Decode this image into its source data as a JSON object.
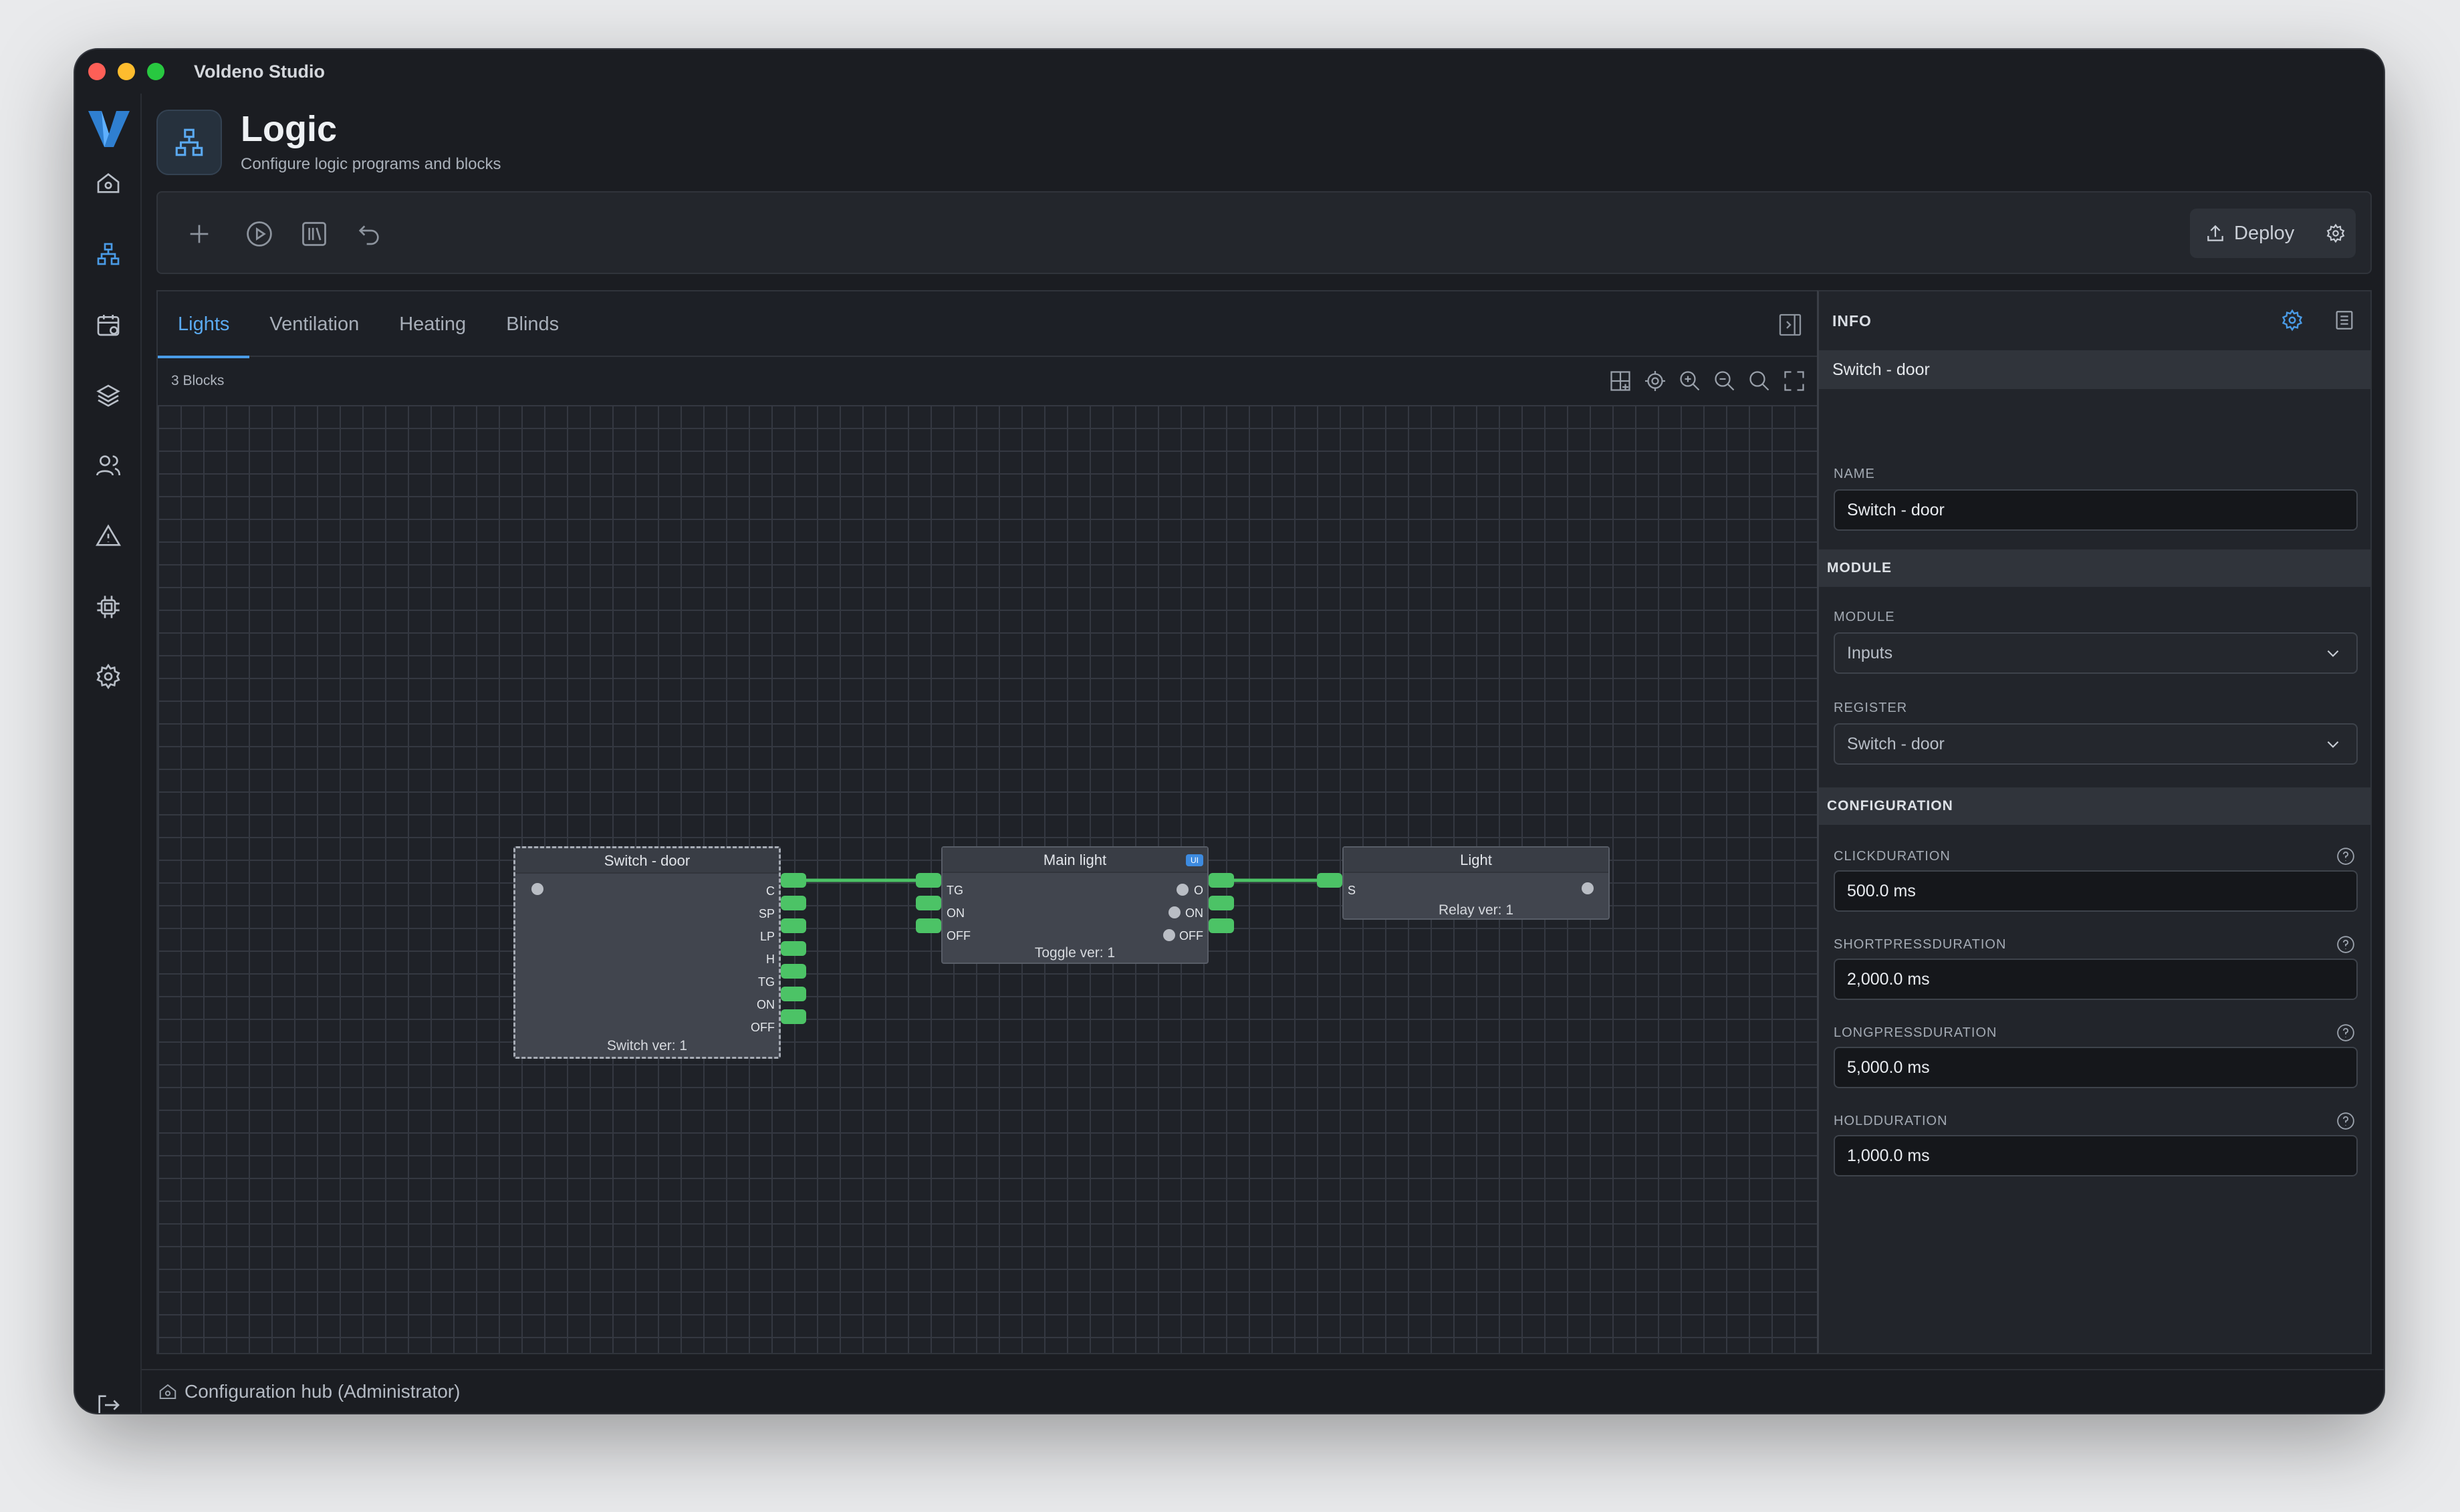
{
  "window": {
    "title": "Voldeno Studio"
  },
  "header": {
    "title": "Logic",
    "subtitle": "Configure logic programs and blocks"
  },
  "toolbar": {
    "deploy_label": "Deploy"
  },
  "tabs": [
    {
      "label": "Lights",
      "active": true
    },
    {
      "label": "Ventilation",
      "active": false
    },
    {
      "label": "Heating",
      "active": false
    },
    {
      "label": "Blinds",
      "active": false
    }
  ],
  "canvas": {
    "block_count": "3 Blocks",
    "nodes": {
      "switch": {
        "title": "Switch - door",
        "footer": "Switch ver: 1",
        "outputs": [
          "C",
          "SP",
          "LP",
          "H",
          "TG",
          "ON",
          "OFF"
        ]
      },
      "toggle": {
        "title": "Main light",
        "footer": "Toggle ver: 1",
        "badge": "UI",
        "inputs": [
          "TG",
          "ON",
          "OFF"
        ],
        "outputs": [
          "O",
          "ON",
          "OFF"
        ]
      },
      "relay": {
        "title": "Light",
        "footer": "Relay ver: 1",
        "inputs": [
          "S"
        ]
      }
    }
  },
  "info_panel": {
    "heading": "INFO",
    "selected": "Switch - door",
    "name_label": "NAME",
    "name_value": "Switch - door",
    "module_section": "MODULE",
    "module_label": "MODULE",
    "module_value": "Inputs",
    "register_label": "REGISTER",
    "register_value": "Switch - door",
    "config_section": "CONFIGURATION",
    "fields": [
      {
        "label": "CLICKDURATION",
        "value": "500.0 ms"
      },
      {
        "label": "SHORTPRESSDURATION",
        "value": "2,000.0 ms"
      },
      {
        "label": "LONGPRESSDURATION",
        "value": "5,000.0 ms"
      },
      {
        "label": "HOLDDURATION",
        "value": "1,000.0 ms"
      }
    ]
  },
  "statusbar": {
    "text": "Configuration hub (Administrator)"
  },
  "colors": {
    "accent": "#4a9be6",
    "port": "#4cc366",
    "background": "#1b1d22"
  }
}
